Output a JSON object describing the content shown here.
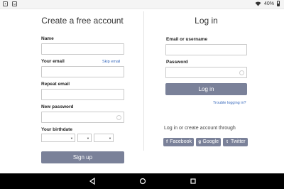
{
  "status_bar": {
    "notif_icon_1": "image-icon",
    "notif_icon_2": "android-icon",
    "battery_text": "40%"
  },
  "signup": {
    "title": "Create a free account",
    "name_label": "Name",
    "email_label": "Your email",
    "skip_email_link": "Skip email",
    "repeat_email_label": "Repeat email",
    "password_label": "New password",
    "birthdate_label": "Your birthdate",
    "signup_button": "Sign up"
  },
  "login": {
    "title": "Log in",
    "username_label": "Email or username",
    "password_label": "Password",
    "login_button": "Log in",
    "trouble_link": "Trouble logging in?",
    "or_text": "Log in or create account through",
    "facebook_button": "Facebook",
    "google_button": "Google",
    "twitter_button": "Twitter"
  },
  "colors": {
    "button_bg": "#7a8199",
    "link": "#3a6bbd"
  }
}
